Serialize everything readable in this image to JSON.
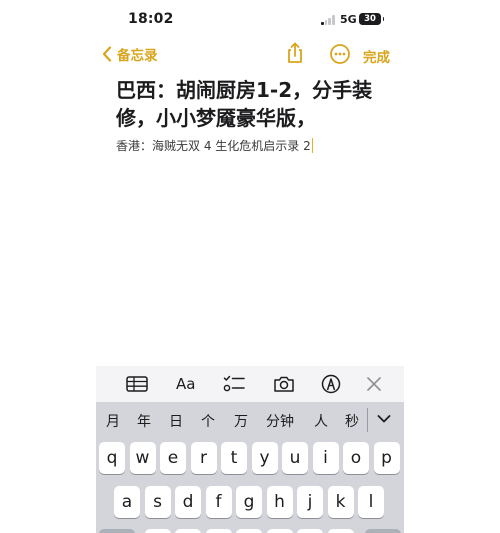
{
  "status_bar": {
    "time": "18:02",
    "network": "5G",
    "battery": "30"
  },
  "nav": {
    "back_label": "备忘录",
    "done_label": "完成"
  },
  "note": {
    "title": "巴西：胡闹厨房1-2，分手装修，小小梦魇豪华版，",
    "body": "香港：海贼无双 4 生化危机启示录 2"
  },
  "toolbar": {
    "format_label": "Aa"
  },
  "keyboard": {
    "candidates": [
      "月",
      "年",
      "日",
      "个",
      "万",
      "分钟",
      "人",
      "秒"
    ],
    "row1": [
      "q",
      "w",
      "e",
      "r",
      "t",
      "y",
      "u",
      "i",
      "o",
      "p"
    ],
    "row2": [
      "a",
      "s",
      "d",
      "f",
      "g",
      "h",
      "j",
      "k",
      "l"
    ]
  },
  "colors": {
    "accent": "#d9a51c",
    "keyboard_bg": "#d3d5da",
    "toolbar_bg": "#f4f4f6"
  }
}
